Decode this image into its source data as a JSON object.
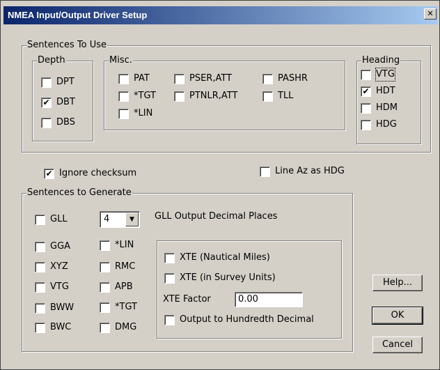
{
  "dialog": {
    "title": "NMEA Input/Output Driver Setup",
    "close_glyph": "✕"
  },
  "use": {
    "legend": "Sentences To Use",
    "depth": {
      "legend": "Depth",
      "items": [
        {
          "label": "DPT",
          "checked": false
        },
        {
          "label": "DBT",
          "checked": true
        },
        {
          "label": "DBS",
          "checked": false
        }
      ]
    },
    "misc": {
      "legend": "Misc.",
      "items": [
        {
          "label": "PAT",
          "checked": false
        },
        {
          "label": "PSER,ATT",
          "checked": false
        },
        {
          "label": "PASHR",
          "checked": false
        },
        {
          "label": "*TGT",
          "checked": false
        },
        {
          "label": "PTNLR,ATT",
          "checked": false
        },
        {
          "label": "TLL",
          "checked": false
        },
        {
          "label": "*LIN",
          "checked": false
        }
      ]
    },
    "heading": {
      "legend": "Heading",
      "items": [
        {
          "label": "VTG",
          "checked": false
        },
        {
          "label": "HDT",
          "checked": true
        },
        {
          "label": "HDM",
          "checked": false
        },
        {
          "label": "HDG",
          "checked": false
        }
      ]
    }
  },
  "options": {
    "ignore_checksum": {
      "label": "Ignore checksum",
      "checked": true
    },
    "line_az": {
      "label": "Line Az as HDG",
      "checked": false
    }
  },
  "generate": {
    "legend": "Sentences to Generate",
    "gll": {
      "label": "GLL",
      "checked": false
    },
    "decimal_places": {
      "value": "4",
      "label": "GLL Output Decimal Places"
    },
    "left_items": [
      {
        "label": "GGA",
        "checked": false
      },
      {
        "label": "XYZ",
        "checked": false
      },
      {
        "label": "VTG",
        "checked": false
      },
      {
        "label": "BWW",
        "checked": false
      },
      {
        "label": "BWC",
        "checked": false
      }
    ],
    "mid_items": [
      {
        "label": "*LIN",
        "checked": false
      },
      {
        "label": "RMC",
        "checked": false
      },
      {
        "label": "APB",
        "checked": false
      },
      {
        "label": "*TGT",
        "checked": false
      },
      {
        "label": "DMG",
        "checked": false
      }
    ],
    "xte_nautical": {
      "label": "XTE (Nautical Miles)",
      "checked": false
    },
    "xte_survey": {
      "label": "XTE (in Survey Units)",
      "checked": false
    },
    "xte_factor": {
      "label": "XTE Factor",
      "value": "0.00"
    },
    "hundredth": {
      "label": "Output to Hundredth Decimal",
      "checked": false
    }
  },
  "buttons": {
    "help": "Help...",
    "ok": "OK",
    "cancel": "Cancel"
  },
  "check_glyph": "✔",
  "dropdown_glyph": "▼"
}
